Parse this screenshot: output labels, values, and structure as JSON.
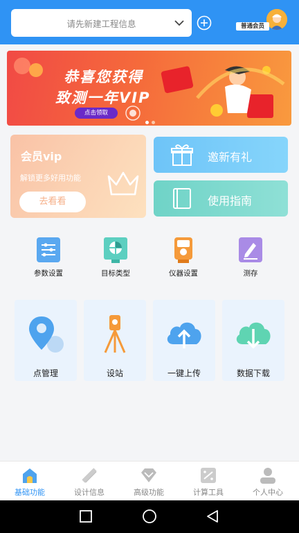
{
  "header": {
    "project_placeholder": "请先新建工程信息",
    "member_level": "普通会员"
  },
  "banner": {
    "line1": "恭喜您获得",
    "line2": "致测一年VIP",
    "button": "点击领取",
    "colors": {
      "from": "#f14a45",
      "to": "#f99a3e"
    }
  },
  "vip_card": {
    "title": "会员vip",
    "subtitle": "解锁更多好用功能",
    "button": "去看看"
  },
  "promo_cards": [
    {
      "label": "邀新有礼",
      "icon": "gift-icon"
    },
    {
      "label": "使用指南",
      "icon": "book-icon"
    }
  ],
  "quick_tools": [
    {
      "label": "参数设置",
      "icon": "sliders-icon"
    },
    {
      "label": "目标类型",
      "icon": "target-icon"
    },
    {
      "label": "仪器设置",
      "icon": "instrument-icon"
    },
    {
      "label": "测存",
      "icon": "measure-save-icon"
    }
  ],
  "functions": [
    {
      "label": "点管理",
      "icon": "location-pin-icon"
    },
    {
      "label": "设站",
      "icon": "tripod-icon"
    },
    {
      "label": "一键上传",
      "icon": "cloud-upload-icon"
    },
    {
      "label": "数据下载",
      "icon": "cloud-download-icon"
    }
  ],
  "tabs": [
    {
      "label": "基础功能",
      "icon": "home-icon",
      "active": true
    },
    {
      "label": "设计信息",
      "icon": "ruler-pencil-icon",
      "active": false
    },
    {
      "label": "高级功能",
      "icon": "diamond-icon",
      "active": false
    },
    {
      "label": "计算工具",
      "icon": "calculator-icon",
      "active": false
    },
    {
      "label": "个人中心",
      "icon": "user-icon",
      "active": false
    }
  ],
  "theme": {
    "primary": "#2f93f4"
  }
}
